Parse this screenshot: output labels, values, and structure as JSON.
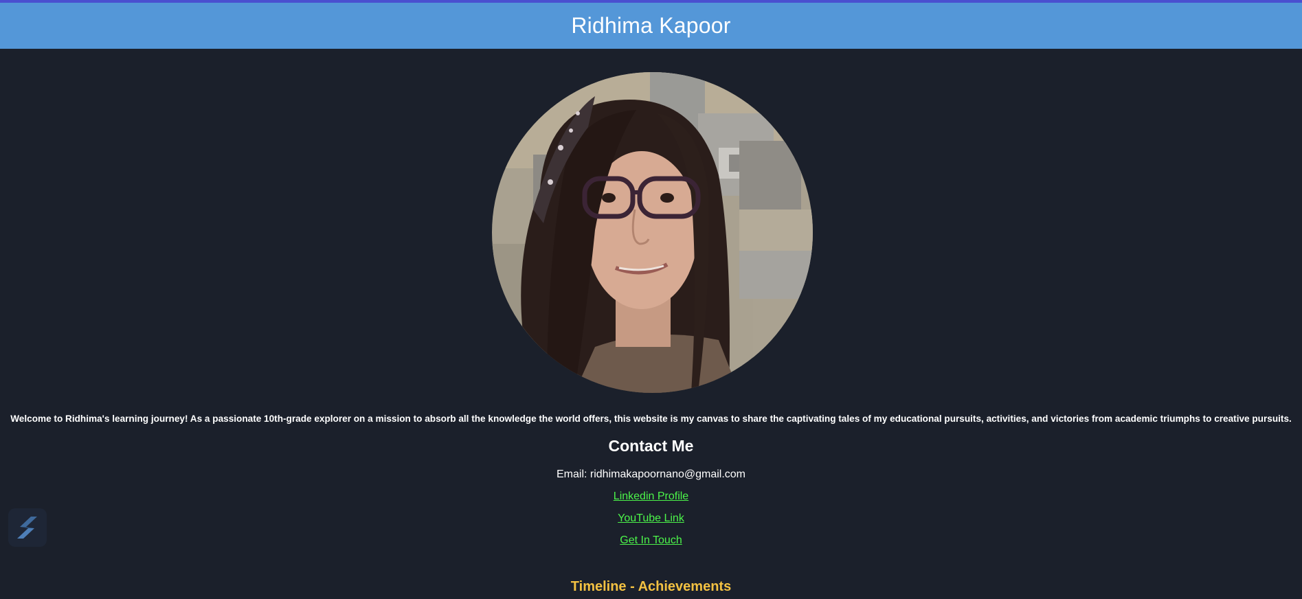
{
  "header": {
    "title": "Ridhima Kapoor"
  },
  "profile": {
    "photo_icon": "profile-photo"
  },
  "intro": {
    "text": "Welcome to Ridhima's learning journey! As a passionate 10th-grade explorer on a mission to absorb all the knowledge the world offers, this website is my canvas to share the captivating tales of my educational pursuits, activities, and victories from academic triumphs to creative pursuits."
  },
  "contact": {
    "heading": "Contact Me",
    "email_line": "Email: ridhimakapoornano@gmail.com",
    "links": {
      "linkedin": "Linkedin Profile",
      "youtube": "YouTube Link",
      "get_in_touch": "Get In Touch"
    }
  },
  "timeline": {
    "heading": "Timeline - Achievements"
  },
  "widget": {
    "icon": "s-logo-icon"
  },
  "colors": {
    "header_bg": "#5497d8",
    "page_bg": "#1b202b",
    "link": "#4cf54a",
    "timeline_heading": "#f3c142",
    "top_strip": "#4a4fd0"
  }
}
